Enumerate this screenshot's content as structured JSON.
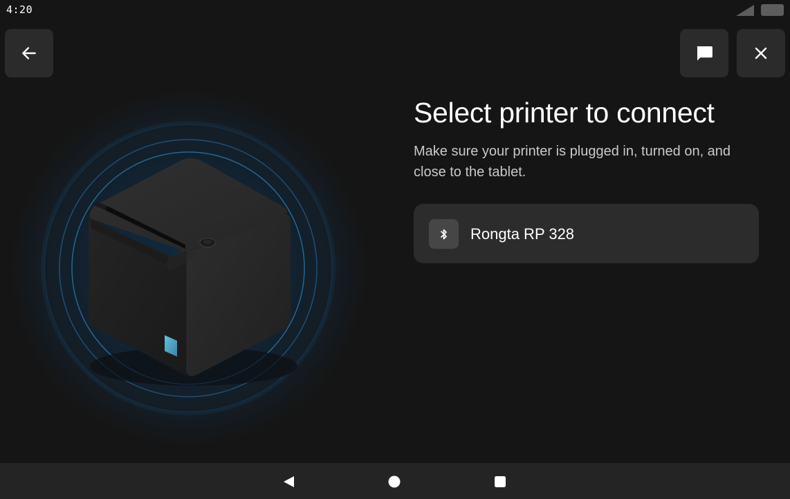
{
  "status_bar": {
    "time": "4:20",
    "signal_icon": "signal-icon",
    "battery_icon": "battery-icon"
  },
  "header": {
    "back_icon": "arrow-left-icon",
    "chat_icon": "chat-icon",
    "close_icon": "close-icon"
  },
  "main": {
    "title": "Select printer to connect",
    "subtitle": "Make sure your printer is plugged in, turned on, and close to the tablet.",
    "printers": [
      {
        "name": "Rongta RP 328",
        "icon": "bluetooth-icon"
      }
    ]
  },
  "nav_bar": {
    "back_icon": "nav-back-icon",
    "home_icon": "nav-home-icon",
    "recents_icon": "nav-recents-icon"
  },
  "colors": {
    "background": "#151515",
    "button": "#2b2b2b",
    "card": "#2c2c2c",
    "ring": "#1c4b6e",
    "printer_led": "#4aa6bf"
  }
}
